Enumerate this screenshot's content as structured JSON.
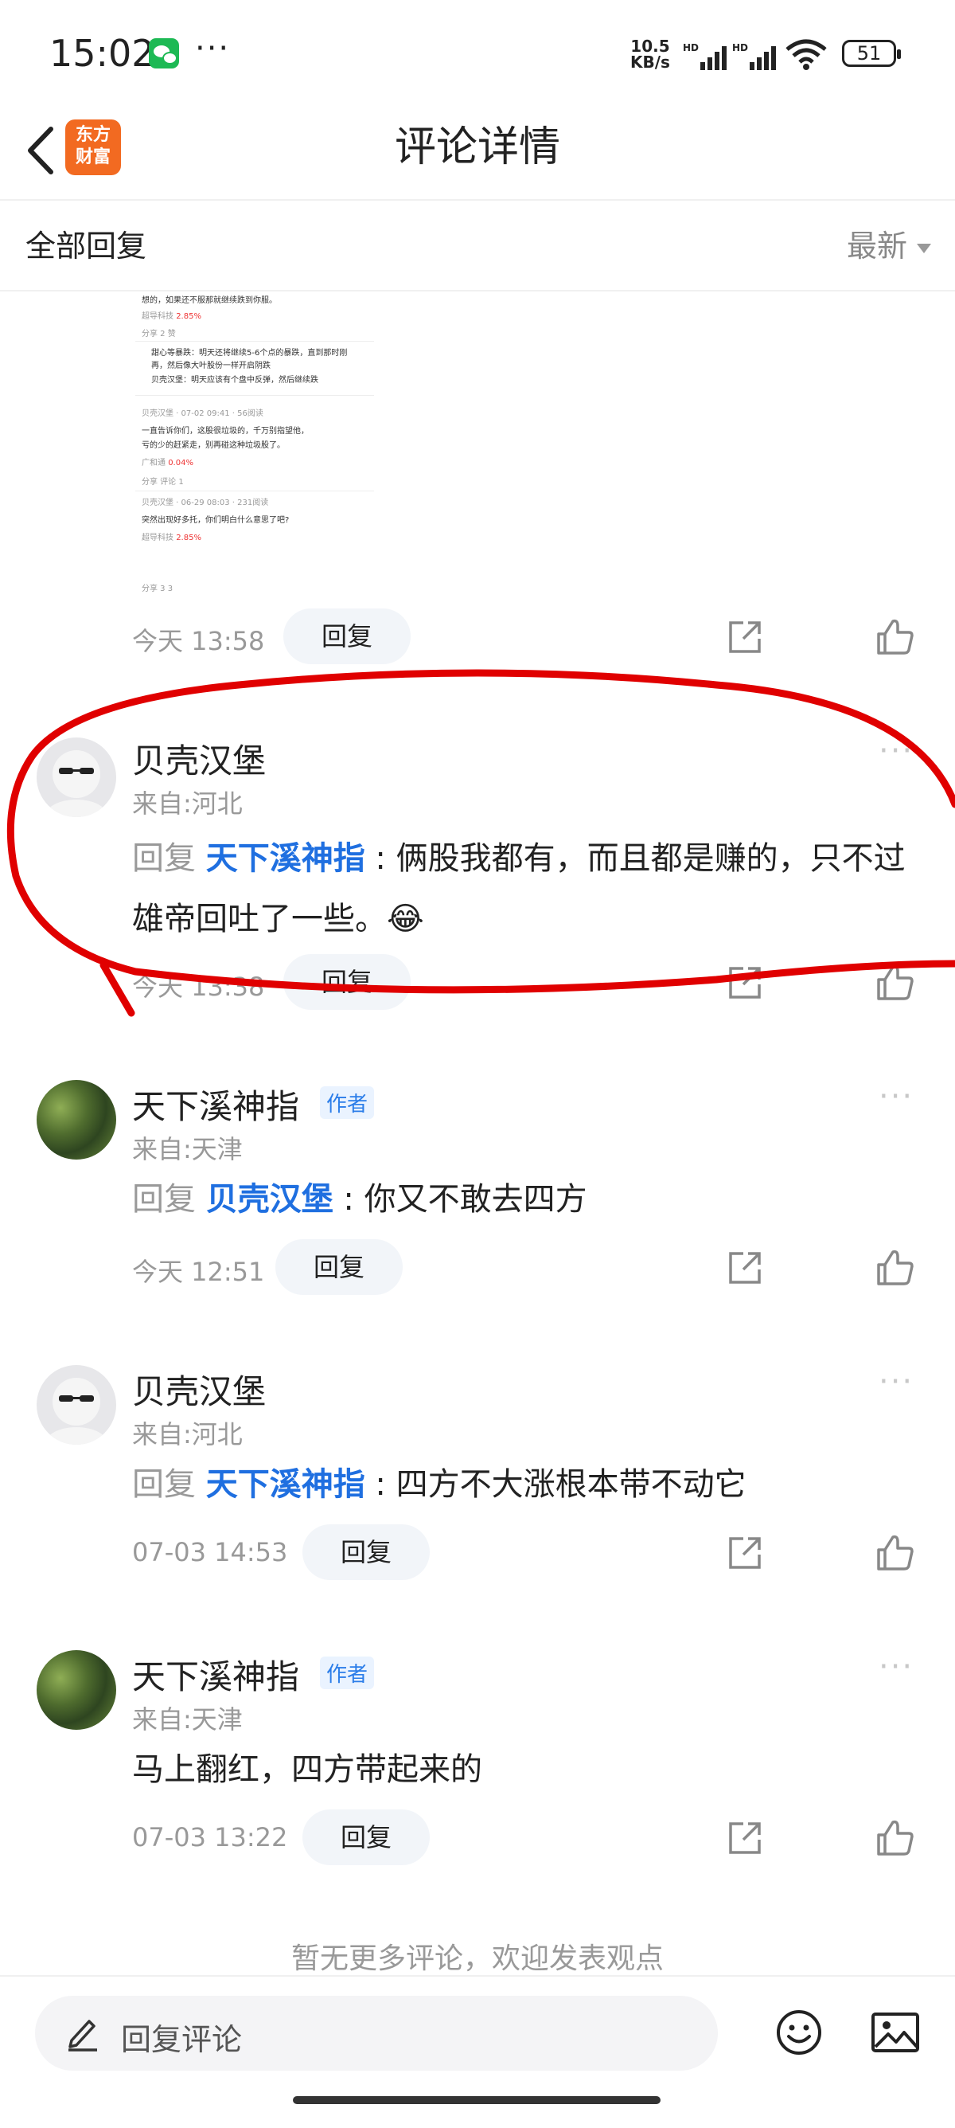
{
  "status_bar": {
    "time": "15:02",
    "net_speed": "10.5",
    "net_unit": "KB/s",
    "hd1": "HD",
    "hd2": "HD",
    "battery": "51"
  },
  "header": {
    "logo_line1": "东方",
    "logo_line2": "财富",
    "title": "评论详情"
  },
  "filter": {
    "label": "全部回复",
    "sort": "最新"
  },
  "thumbnail": {
    "line1": "想的，如果还不服那就继续跌到你服。",
    "line1_stock": "超导科技",
    "line1_change": "2.85%",
    "line1_actions": "分享   2   赞",
    "reply_a": "甜心等暴跌：明天还将继续5-6个点的暴跌，直到那时刚",
    "reply_a2": "再，然后像大叶股份一样开启阴跌",
    "reply_b": "贝壳汉堡：明天应该有个盘中反弹，然后继续跌",
    "post2_user": "贝壳汉堡 · 07-02 09:41 · 56阅读",
    "post2_text1": "一直告诉你们，这股很垃圾的，千万别指望他，",
    "post2_text2": "亏的少的赶紧走，别再碰这种垃圾股了。",
    "post2_stock": "广和通",
    "post2_change": "0.04%",
    "post2_actions": "分享   评论   1",
    "post3_user": "贝壳汉堡 · 06-29 08:03 · 231阅读",
    "post3_text": "突然出现好多托，你们明白什么意思了吧?",
    "post3_stock": "超导科技",
    "post3_change": "2.85%",
    "post3_actions": "分享   3   3",
    "time": "今天 13:58",
    "reply_label": "回复"
  },
  "comments": [
    {
      "user": "贝壳汉堡",
      "location": "来自:河北",
      "reply_prefix": "回复",
      "reply_to": "天下溪神指",
      "sep": " : ",
      "text": "俩股我都有，而且都是赚的，只不过雄帝回吐了一些。",
      "emoji": "😂",
      "time": "今天 13:38",
      "reply_label": "回复"
    },
    {
      "user": "天下溪神指",
      "author_tag": "作者",
      "location": "来自:天津",
      "reply_prefix": "回复",
      "reply_to": "贝壳汉堡",
      "sep": " : ",
      "text": "你又不敢去四方",
      "time": "今天 12:51",
      "reply_label": "回复"
    },
    {
      "user": "贝壳汉堡",
      "location": "来自:河北",
      "reply_prefix": "回复",
      "reply_to": "天下溪神指",
      "sep": " : ",
      "text": "四方不大涨根本带不动它",
      "time": "07-03 14:53",
      "reply_label": "回复"
    },
    {
      "user": "天下溪神指",
      "author_tag": "作者",
      "location": "来自:天津",
      "text": "马上翻红，四方带起来的",
      "time": "07-03 13:22",
      "reply_label": "回复"
    }
  ],
  "footer_note": "暂无更多评论，欢迎发表观点",
  "bottom_bar": {
    "placeholder": "回复评论"
  },
  "colors": {
    "accent": "#1f6fe0",
    "logo": "#f26a21",
    "annotation": "#e00000"
  }
}
